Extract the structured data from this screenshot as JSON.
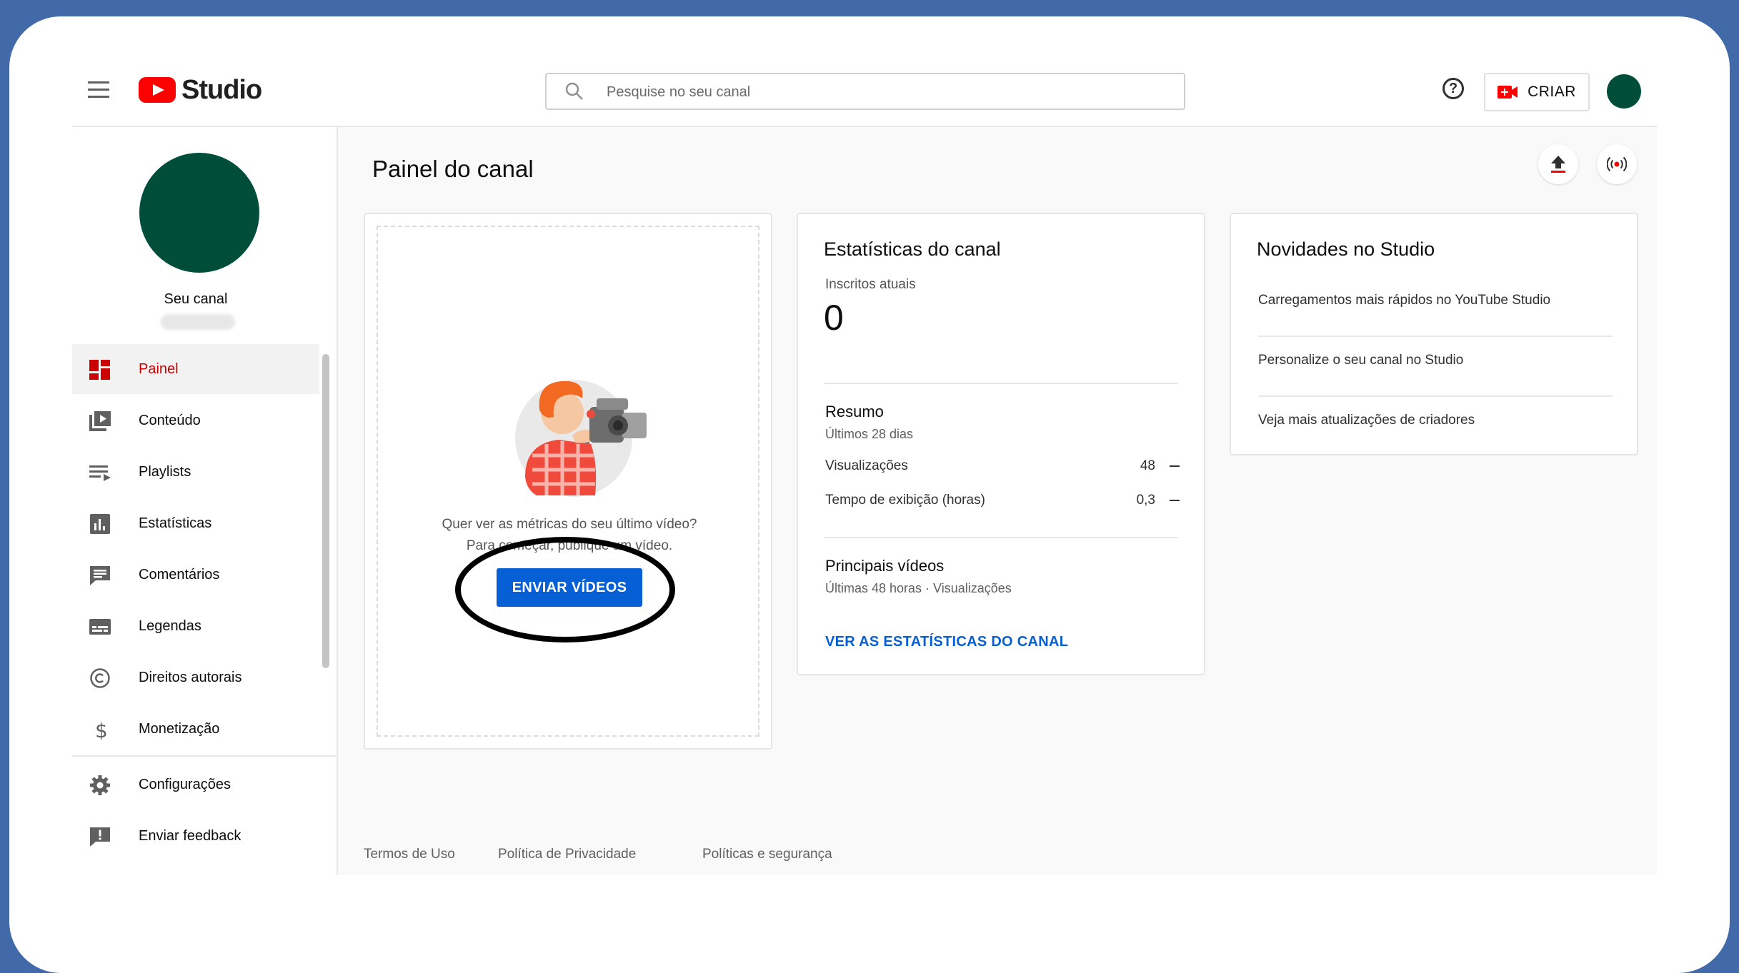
{
  "header": {
    "logo_text": "Studio",
    "search_placeholder": "Pesquise no seu canal",
    "help_glyph": "?",
    "create_label": "CRIAR"
  },
  "sidebar": {
    "channel_label": "Seu canal",
    "items": [
      {
        "label": "Painel",
        "icon": "dashboard-icon",
        "active": true
      },
      {
        "label": "Conteúdo",
        "icon": "content-icon"
      },
      {
        "label": "Playlists",
        "icon": "playlist-icon"
      },
      {
        "label": "Estatísticas",
        "icon": "analytics-icon"
      },
      {
        "label": "Comentários",
        "icon": "comments-icon"
      },
      {
        "label": "Legendas",
        "icon": "subtitles-icon"
      },
      {
        "label": "Direitos autorais",
        "icon": "copyright-icon"
      },
      {
        "label": "Monetização",
        "icon": "dollar-icon"
      }
    ],
    "bottom_items": [
      {
        "label": "Configurações",
        "icon": "gear-icon"
      },
      {
        "label": "Enviar feedback",
        "icon": "feedback-icon"
      }
    ]
  },
  "main": {
    "page_title": "Painel do canal",
    "upload_card": {
      "prompt_line1": "Quer ver as métricas do seu último vídeo?",
      "prompt_line2": "Para começar, publique um vídeo.",
      "button_label": "ENVIAR VÍDEOS"
    },
    "stats_card": {
      "title": "Estatísticas do canal",
      "subscribers_label": "Inscritos atuais",
      "subscribers_value": "0",
      "summary_title": "Resumo",
      "summary_period": "Últimos 28 dias",
      "metrics": [
        {
          "label": "Visualizações",
          "value": "48"
        },
        {
          "label": "Tempo de exibição (horas)",
          "value": "0,3"
        }
      ],
      "top_videos_title": "Principais vídeos",
      "top_videos_sub": "Últimas 48 horas · Visualizações",
      "link_label": "VER AS ESTATÍSTICAS DO CANAL"
    },
    "news_card": {
      "title": "Novidades no Studio",
      "items": [
        "Carregamentos mais rápidos no YouTube Studio",
        "Personalize o seu canal no Studio",
        "Veja mais atualizações de criadores"
      ]
    },
    "footer": {
      "terms": "Termos de Uso",
      "privacy": "Política de Privacidade",
      "policies": "Políticas e segurança"
    }
  },
  "colors": {
    "background_frame": "#4269a8",
    "accent_red": "#ff0000",
    "link_blue": "#065fd4",
    "avatar_green": "#004d3a"
  }
}
